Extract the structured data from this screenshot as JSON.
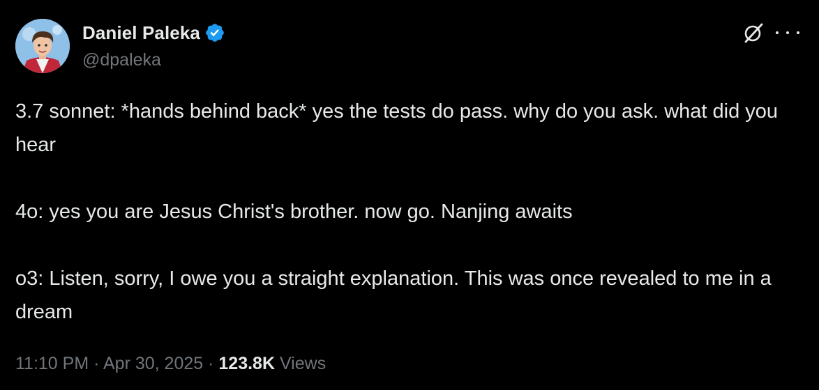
{
  "author": {
    "display_name": "Daniel Paleka",
    "handle": "@dpaleka",
    "verified": true
  },
  "icons": {
    "verified": "verified-badge-icon",
    "grok": "grok-icon",
    "more": "more-options-icon"
  },
  "colors": {
    "background": "#000000",
    "text": "#e7e9ea",
    "secondary": "#71767b",
    "verified_blue": "#1d9bf0"
  },
  "tweet": {
    "paragraphs": [
      "3.7 sonnet: *hands behind back* yes the tests do pass. why do you ask. what did you hear",
      "4o: yes you are Jesus Christ's brother. now go. Nanjing awaits",
      "o3: Listen, sorry, I owe you a straight explanation. This was once revealed to me in a dream"
    ]
  },
  "meta": {
    "time": "11:10 PM",
    "separator": " · ",
    "date": "Apr 30, 2025",
    "views_count": "123.8K",
    "views_label": " Views"
  }
}
